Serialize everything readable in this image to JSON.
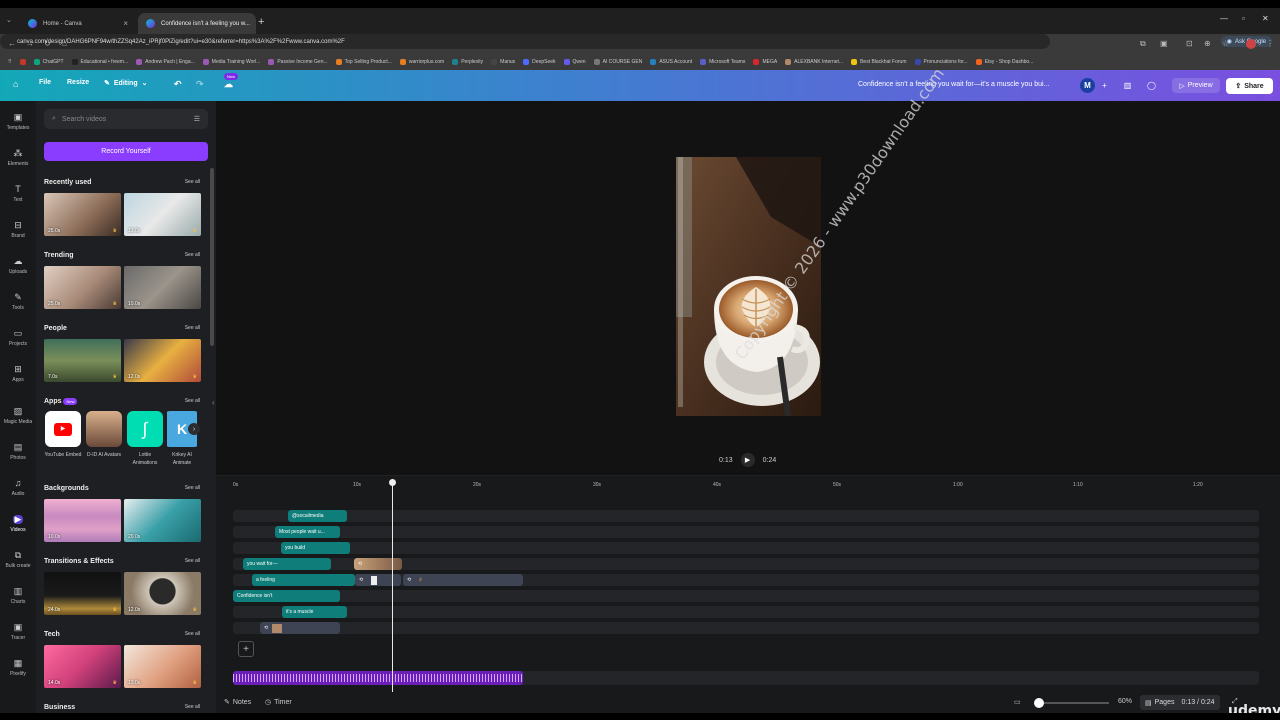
{
  "browser": {
    "tabs": [
      {
        "title": "Home - Canva"
      },
      {
        "title": "Confidence isn't a feeling you w..."
      }
    ],
    "url": "canva.com/design/DAHG6PNF94w/thZZSq42Az_iPRjf0PlZig/edit?ui=e30&referrer=https%3A%2F%2Fwww.canva.com%2F",
    "ask_google": "Ask Google",
    "bookmarks": [
      "ChatGPT",
      "Educational • freem...",
      "Andrew Pach | Enga...",
      "Media Training Worl...",
      "Passive Income Gen...",
      "Top Selling Product...",
      "warriorplus.com",
      "Perplexity",
      "Manus",
      "DeepSeek",
      "Qwen",
      "AI COURSE GEN",
      "ASUS Account",
      "Microsoft Teams",
      "MEGA",
      "ALEXBANK Internet...",
      "Best Blackhat Forum",
      "Pronunciations for...",
      "Etsy - Shop Dashbo..."
    ]
  },
  "header": {
    "file": "File",
    "resize": "Resize",
    "editing": "Editing",
    "new_badge": "New",
    "title": "Confidence isn't a feeling you wait for—it's a muscle you bui...",
    "avatar": "M",
    "preview": "Preview",
    "share": "Share"
  },
  "rail": [
    {
      "label": "Templates",
      "icon": "templates-icon"
    },
    {
      "label": "Elements",
      "icon": "elements-icon"
    },
    {
      "label": "Text",
      "icon": "text-icon"
    },
    {
      "label": "Brand",
      "icon": "brand-icon"
    },
    {
      "label": "Uploads",
      "icon": "uploads-icon"
    },
    {
      "label": "Tools",
      "icon": "tools-icon"
    },
    {
      "label": "Projects",
      "icon": "projects-icon"
    },
    {
      "label": "Apps",
      "icon": "apps-icon"
    },
    {
      "label": "Magic Media",
      "icon": "magic-media-icon"
    },
    {
      "label": "Photos",
      "icon": "photos-icon"
    },
    {
      "label": "Audio",
      "icon": "audio-icon"
    },
    {
      "label": "Videos",
      "icon": "videos-icon"
    },
    {
      "label": "Bulk create",
      "icon": "bulk-create-icon"
    },
    {
      "label": "Charts",
      "icon": "charts-icon"
    },
    {
      "label": "Tracer",
      "icon": "tracer-icon"
    },
    {
      "label": "Pixelify",
      "icon": "pixelify-icon"
    }
  ],
  "panel": {
    "search_placeholder": "Search videos",
    "record": "Record Yourself",
    "see_all": "See all",
    "sections": {
      "recent": {
        "title": "Recently used",
        "durations": [
          "25.0s",
          "13.0s"
        ]
      },
      "trending": {
        "title": "Trending",
        "durations": [
          "25.0s",
          "10.0s"
        ]
      },
      "people": {
        "title": "People",
        "durations": [
          "7.0s",
          "12.0s"
        ]
      },
      "apps": {
        "title": "Apps",
        "badge": "New"
      },
      "backgrounds": {
        "title": "Backgrounds",
        "durations": [
          "10.0s",
          "20.0s"
        ]
      },
      "transitions": {
        "title": "Transitions & Effects",
        "durations": [
          "24.0s",
          "12.0s"
        ]
      },
      "tech": {
        "title": "Tech",
        "durations": [
          "14.0s",
          "13.0s"
        ]
      },
      "business": {
        "title": "Business"
      }
    },
    "apps": [
      "YouTube Embed",
      "D-ID AI Avatars",
      "Lottie Animations",
      "Krikey AI Animate"
    ]
  },
  "canvas": {
    "watermark": "Copyright © 2026 - www.p30download.com",
    "current_time": "0:13",
    "total_time": "0:24"
  },
  "timeline": {
    "ticks": [
      "0s",
      "10s",
      "20s",
      "30s",
      "40s",
      "50s",
      "1:00",
      "1:10",
      "1:20"
    ],
    "clips": [
      "@socailmedia",
      "Most people wait u...",
      "you build",
      "you wait for—",
      "a feeling",
      "Confidence isn't",
      "it's a muscle"
    ]
  },
  "footer": {
    "notes": "Notes",
    "timer": "Timer",
    "zoom": "60%",
    "pages": "Pages",
    "time": "0:13 / 0:24"
  },
  "overlay": {
    "udemy": "udemy"
  }
}
